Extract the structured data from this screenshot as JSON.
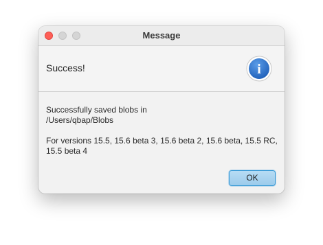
{
  "window": {
    "title": "Message"
  },
  "header": {
    "text": "Success!",
    "icon": "info-icon",
    "icon_glyph": "i",
    "icon_color": "#2f73c9"
  },
  "body": {
    "line1": "Successfully saved blobs in",
    "line2": "/Users/qbap/Blobs",
    "line3": "For versions 15.5, 15.6 beta 3, 15.6 beta 2, 15.6 beta, 15.5 RC,",
    "line4": "15.5 beta 4"
  },
  "buttons": {
    "ok_label": "OK"
  },
  "colors": {
    "close": "#fe5f57",
    "inactive_light": "#d5d5d5",
    "ok_button": "#a9d3f0"
  }
}
